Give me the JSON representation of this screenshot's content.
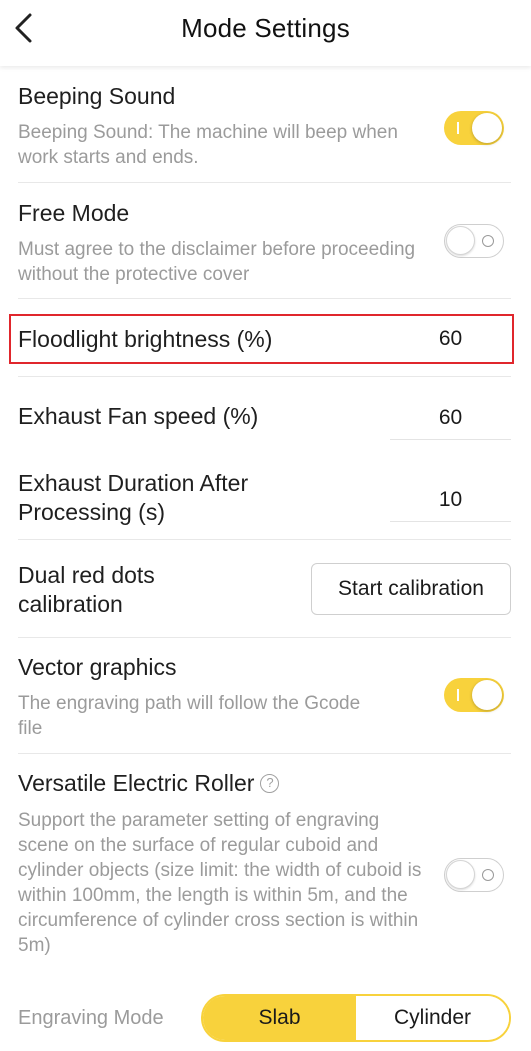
{
  "header": {
    "title": "Mode Settings"
  },
  "beeping": {
    "title": "Beeping Sound",
    "desc": "Beeping Sound: The machine will beep when work starts and ends.",
    "enabled": true
  },
  "free_mode": {
    "title": "Free Mode",
    "desc": "Must agree to the disclaimer before proceeding without the protective cover",
    "enabled": false
  },
  "floodlight": {
    "label": "Floodlight brightness (%)",
    "value": "60"
  },
  "fan": {
    "label": "Exhaust Fan speed (%)",
    "value": "60"
  },
  "exhaust_duration": {
    "label_line1": "Exhaust Duration After",
    "label_line2": "Processing (s)",
    "value": "10"
  },
  "dual_dots": {
    "label_line1": "Dual red dots",
    "label_line2": "calibration",
    "button": "Start calibration"
  },
  "vector": {
    "title": "Vector graphics",
    "desc": "The engraving path will follow the Gcode file",
    "enabled": true
  },
  "roller": {
    "title": "Versatile Electric Roller",
    "help": "?",
    "desc": "Support the parameter setting of engraving scene on the surface of regular cuboid and cylinder objects (size limit: the width of cuboid is within 100mm, the length is within 5m, and the circumference of cylinder cross section is within 5m)",
    "enabled": false
  },
  "engraving_mode": {
    "label": "Engraving Mode",
    "options": [
      "Slab",
      "Cylinder"
    ],
    "selected": "Slab"
  },
  "colors": {
    "accent": "#f8d23c",
    "highlight": "#e0262c"
  }
}
